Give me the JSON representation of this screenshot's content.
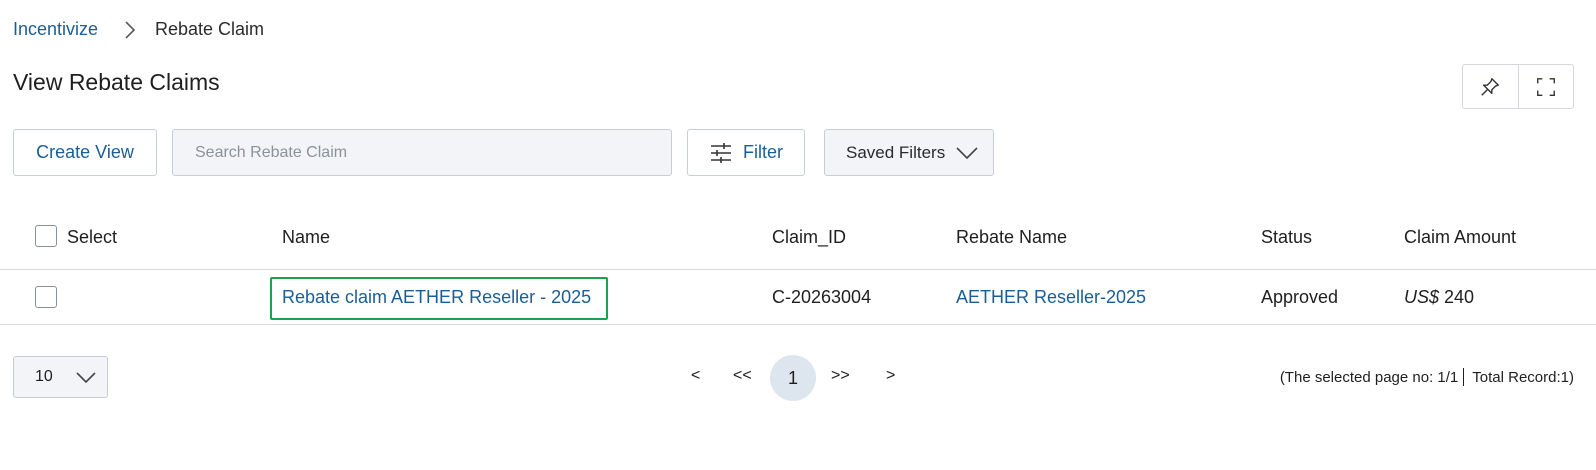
{
  "breadcrumb": {
    "root": "Incentivize",
    "current": "Rebate Claim"
  },
  "page_title": "View Rebate Claims",
  "toolbar": {
    "create_view_label": "Create View",
    "search_placeholder": "Search Rebate Claim",
    "filter_label": "Filter",
    "saved_filters_label": "Saved Filters"
  },
  "table": {
    "columns": [
      "Select",
      "Name",
      "Claim_ID",
      "Rebate Name",
      "Status",
      "Claim Amount"
    ],
    "rows": [
      {
        "name": "Rebate claim AETHER Reseller - 2025",
        "claim_id": "C-20263004",
        "rebate_name": "AETHER Reseller-2025",
        "status": "Approved",
        "currency": "US$",
        "amount": "240"
      }
    ]
  },
  "pagination": {
    "page_size": "10",
    "prev": "<",
    "first": "<<",
    "current_page": "1",
    "last": ">>",
    "next": ">",
    "info_left": "(The selected page no: 1/1",
    "info_right": "Total Record:1)"
  },
  "colors": {
    "link": "#1a5e96",
    "highlight": "#1aa34a",
    "field_bg": "#f2f4f7"
  },
  "icons": [
    "chevron-right-icon",
    "pin-icon",
    "expand-icon",
    "filter-sliders-icon",
    "chevron-down-icon"
  ]
}
